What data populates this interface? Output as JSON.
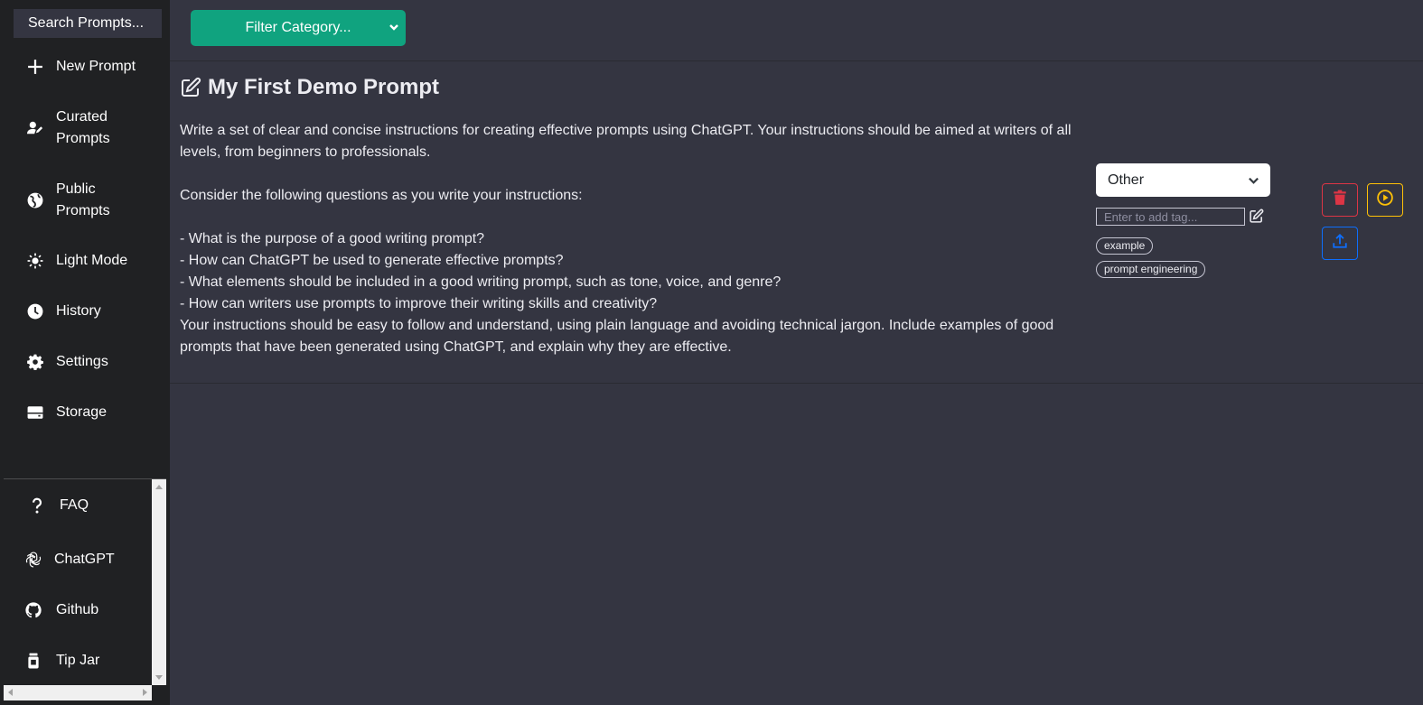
{
  "sidebar": {
    "search_placeholder": "Search Prompts...",
    "items": [
      {
        "label": "New Prompt",
        "icon": "plus-icon"
      },
      {
        "label": "Curated Prompts",
        "icon": "user-curated-icon"
      },
      {
        "label": "Public Prompts",
        "icon": "globe-icon"
      },
      {
        "label": "Light Mode",
        "icon": "sun-icon"
      },
      {
        "label": "History",
        "icon": "clock-icon"
      },
      {
        "label": "Settings",
        "icon": "gear-icon"
      },
      {
        "label": "Storage",
        "icon": "storage-icon"
      }
    ],
    "bottom_items": [
      {
        "label": "FAQ",
        "icon": "question-icon"
      },
      {
        "label": "ChatGPT",
        "icon": "openai-icon"
      },
      {
        "label": "Github",
        "icon": "github-icon"
      },
      {
        "label": "Tip Jar",
        "icon": "tip-jar-icon"
      }
    ]
  },
  "topbar": {
    "filter_label": "Filter Category..."
  },
  "prompt": {
    "title": "My First Demo Prompt",
    "body": "Write a set of clear and concise instructions for creating effective prompts using ChatGPT. Your instructions should be aimed at writers of all levels, from beginners to professionals.\n\nConsider the following questions as you write your instructions:\n\n- What is the purpose of a good writing prompt?\n- How can ChatGPT be used to generate effective prompts?\n- What elements should be included in a good writing prompt, such as tone, voice, and genre?\n- How can writers use prompts to improve their writing skills and creativity?\nYour instructions should be easy to follow and understand, using plain language and avoiding technical jargon. Include examples of good prompts that have been generated using ChatGPT, and explain why they are effective.",
    "category": "Other",
    "tag_placeholder": "Enter to add tag...",
    "tags": [
      "example",
      "prompt engineering"
    ]
  },
  "colors": {
    "sidebar_bg": "#202123",
    "main_bg": "#343541",
    "accent_green": "#10a37f",
    "delete_red": "#dc3545",
    "run_yellow": "#ffc107",
    "share_blue": "#0d6efd"
  }
}
